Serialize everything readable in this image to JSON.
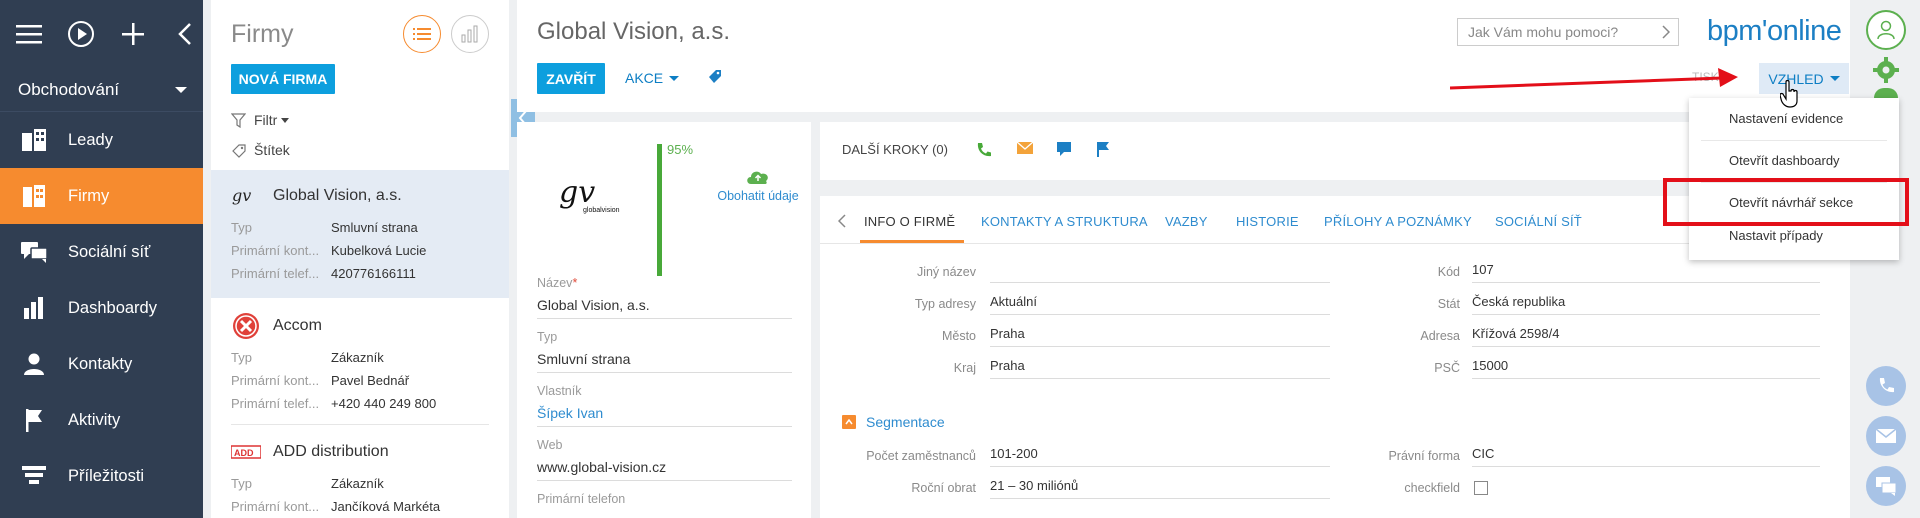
{
  "nav": {
    "workspace": "Obchodování",
    "items": [
      {
        "label": "Leady",
        "icon": "leads-icon"
      },
      {
        "label": "Firmy",
        "icon": "accounts-icon"
      },
      {
        "label": "Sociální síť",
        "icon": "social-network-icon"
      },
      {
        "label": "Dashboardy",
        "icon": "dashboards-icon"
      },
      {
        "label": "Kontakty",
        "icon": "contacts-icon"
      },
      {
        "label": "Aktivity",
        "icon": "activities-flag-icon"
      },
      {
        "label": "Příležitosti",
        "icon": "opportunities-funnel-icon"
      }
    ],
    "active_index": 1
  },
  "list": {
    "title": "Firmy",
    "new_button": "NOVÁ FIRMA",
    "filter_label": "Filtr",
    "tag_label": "Štítek",
    "records": [
      {
        "name": "Global Vision, a.s.",
        "fields": [
          {
            "k": "Typ",
            "v": "Smluvní strana"
          },
          {
            "k": "Primární kont...",
            "v": "Kubelková Lucie"
          },
          {
            "k": "Primární telef...",
            "v": "420776166111"
          }
        ]
      },
      {
        "name": "Accom",
        "fields": [
          {
            "k": "Typ",
            "v": "Zákazník"
          },
          {
            "k": "Primární kont...",
            "v": "Pavel Bednář"
          },
          {
            "k": "Primární telef...",
            "v": "+420 440 249 800"
          }
        ]
      },
      {
        "name": "ADD distribution",
        "fields": [
          {
            "k": "Typ",
            "v": "Zákazník"
          },
          {
            "k": "Primární kont...",
            "v": "Jančíková Markéta"
          }
        ]
      }
    ]
  },
  "page": {
    "title": "Global Vision, a.s.",
    "close_button": "ZAVŘÍT",
    "actions_button": "AKCE",
    "help_placeholder": "Jak Vám mohu pomoci?",
    "brand": "bpm'online",
    "print_label": "TISK",
    "view_button": "VZHLED"
  },
  "profile": {
    "completeness": "95%",
    "completeness_value": 0.95,
    "enrich_label": "Obohatit údaje",
    "fields": [
      {
        "label": "Název",
        "required": "*",
        "value": "Global Vision, a.s."
      },
      {
        "label": "Typ",
        "value": "Smluvní strana"
      },
      {
        "label": "Vlastník",
        "value": "Šípek Ivan"
      },
      {
        "label": "Web",
        "value": "www.global-vision.cz"
      },
      {
        "label": "Primární telefon",
        "value": ""
      }
    ]
  },
  "next_steps": {
    "label": "DALŠÍ KROKY (0)"
  },
  "tabs": [
    "INFO O FIRMĚ",
    "KONTAKTY A STRUKTURA",
    "VAZBY",
    "HISTORIE",
    "PŘÍLOHY A POZNÁMKY",
    "SOCIÁLNÍ SÍŤ"
  ],
  "info": {
    "left": [
      {
        "k": "Jiný název",
        "v": ""
      },
      {
        "k": "Typ adresy",
        "v": "Aktuální"
      },
      {
        "k": "Město",
        "v": "Praha"
      },
      {
        "k": "Kraj",
        "v": "Praha"
      }
    ],
    "right": [
      {
        "k": "Kód",
        "v": "107"
      },
      {
        "k": "Stát",
        "v": "Česká republika"
      },
      {
        "k": "Adresa",
        "v": "Křížová 2598/4"
      },
      {
        "k": "PSČ",
        "v": "15000"
      }
    ],
    "segment_title": "Segmentace",
    "segment_left": [
      {
        "k": "Počet zaměstnanců",
        "v": "101-200"
      },
      {
        "k": "Roční obrat",
        "v": "21 – 30 miliónů"
      }
    ],
    "segment_right": [
      {
        "k": "Právní forma",
        "v": "CIC"
      },
      {
        "k": "checkfield",
        "v": ""
      }
    ]
  },
  "menu": {
    "items": [
      "Nastavení evidence",
      "Otevřít dashboardy",
      "Otevřít návrhář sekce",
      "Nastavit případy"
    ]
  },
  "colors": {
    "accent": "#f68b2f",
    "primary": "#0d9fde",
    "nav": "#303e52",
    "highlight": "#e30f19"
  }
}
